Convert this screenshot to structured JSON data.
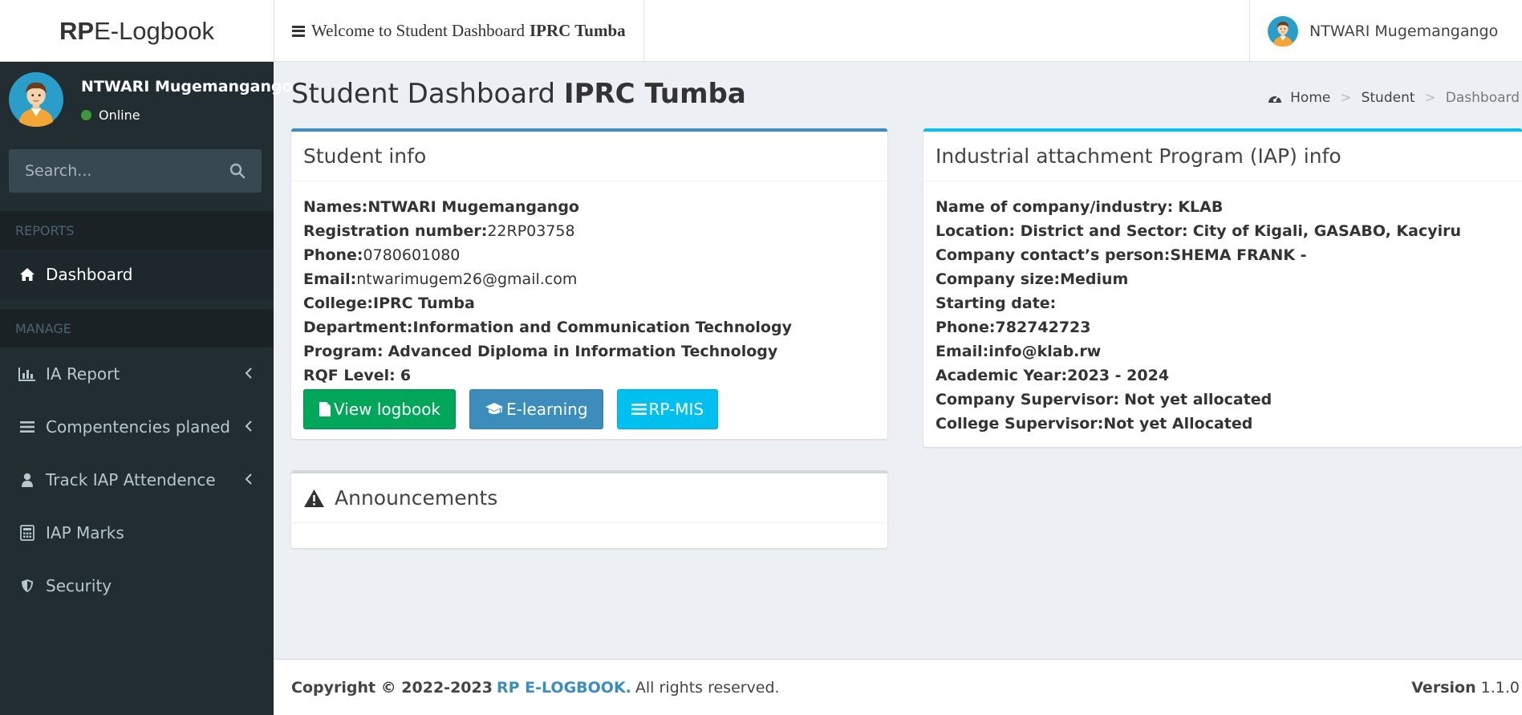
{
  "header": {
    "logo_strong": "RP",
    "logo_rest": "E-Logbook",
    "welcome_text": "Welcome to Student Dashboard",
    "welcome_strong": "IPRC Tumba",
    "user_name": "NTWARI Mugemangango"
  },
  "sidebar": {
    "user_name": "NTWARI Mugemangango",
    "status": "Online",
    "search_placeholder": "Search...",
    "section_reports": "REPORTS",
    "section_manage": "MANAGE",
    "items": [
      {
        "label": "Dashboard",
        "icon": "home-icon",
        "active": true
      },
      {
        "label": "IA Report",
        "icon": "bar-chart-icon"
      },
      {
        "label": "Compentencies planed",
        "icon": "list-icon"
      },
      {
        "label": "Track IAP Attendence",
        "icon": "user-icon"
      },
      {
        "label": "IAP Marks",
        "icon": "calculator-icon"
      },
      {
        "label": "Security",
        "icon": "shield-icon"
      }
    ]
  },
  "page": {
    "title": "Student Dashboard",
    "title_strong": "IPRC Tumba",
    "breadcrumb": [
      "Home",
      "Student",
      "Dashboard"
    ]
  },
  "student_info": {
    "title": "Student info",
    "names_label": "Names:",
    "names_value": "NTWARI Mugemangango",
    "reg_label": "Registration number:",
    "reg_value": "22RP03758",
    "phone_label": "Phone:",
    "phone_value": "0780601080",
    "email_label": "Email:",
    "email_value": "ntwarimugem26@gmail.com",
    "college_label": "College:",
    "college_value": "IPRC Tumba",
    "department_label": "Department:",
    "department_value": "Information and Communication Technology",
    "program_label": "Program:",
    "program_value": "Advanced Diploma in Information Technology",
    "rqf_label": "RQF Level:",
    "rqf_value": "6",
    "buttons": {
      "view_logbook": "View logbook",
      "elearning": "E-learning",
      "rpmis": "RP-MIS"
    }
  },
  "announcements": {
    "title": "Announcements"
  },
  "iap_info": {
    "title": "Industrial attachment Program (IAP) info",
    "company_label": "Name of company/industry:",
    "company_value": "KLAB",
    "location_label": "Location: District and Sector:",
    "location_value": "City of Kigali, GASABO, Kacyiru",
    "contact_label": "Company contact’s person:",
    "contact_value": "SHEMA FRANK -",
    "size_label": "Company size:",
    "size_value": "Medium",
    "start_label": "Starting date:",
    "start_value": "",
    "phone_label": "Phone:",
    "phone_value": "782742723",
    "email_label": "Email:",
    "email_value": "info@klab.rw",
    "year_label": "Academic Year:",
    "year_value": "2023 - 2024",
    "company_sup_label": "Company Supervisor:",
    "company_sup_value": "Not yet allocated",
    "college_sup_label": "College Supervisor:",
    "college_sup_value": "Not yet Allocated"
  },
  "footer": {
    "copyright": "Copyright © 2022-2023",
    "brand": "RP E-LOGBOOK.",
    "rights": "All rights reserved.",
    "version_label": "Version",
    "version_value": "1.1.0"
  },
  "colors": {
    "sidebar_bg": "#222d32",
    "primary": "#3c8dbc",
    "success": "#00a65a",
    "info": "#00c0ef",
    "content_bg": "#ecf0f5"
  }
}
